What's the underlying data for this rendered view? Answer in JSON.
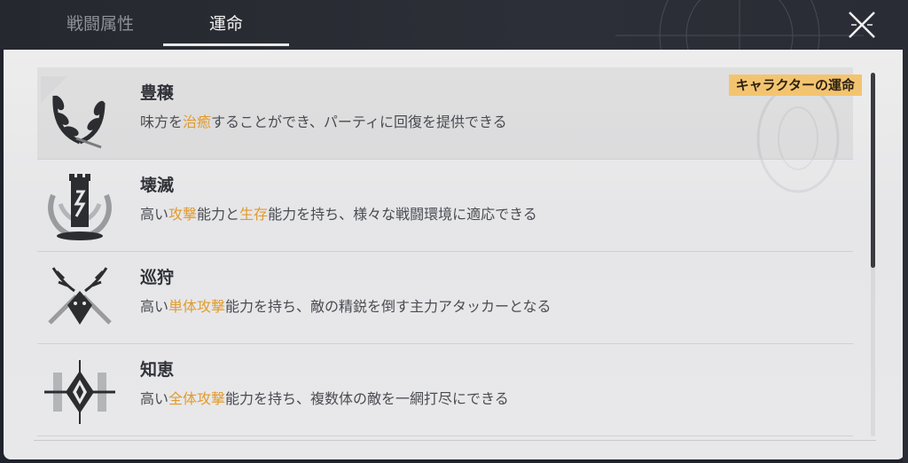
{
  "tabs": [
    {
      "label": "戦闘属性",
      "active": false
    },
    {
      "label": "運命",
      "active": true
    }
  ],
  "paths": [
    {
      "title": "豊穣",
      "selected": true,
      "badge": "キャラクターの運命",
      "icon": "abundance-wheat-icon",
      "desc_parts": [
        {
          "text": "味方を",
          "hl": false
        },
        {
          "text": "治癒",
          "hl": true
        },
        {
          "text": "することができ、パーティに回復を提供できる",
          "hl": false
        }
      ]
    },
    {
      "title": "壊滅",
      "selected": false,
      "icon": "destruction-tower-icon",
      "desc_parts": [
        {
          "text": "高い",
          "hl": false
        },
        {
          "text": "攻撃",
          "hl": true
        },
        {
          "text": "能力と",
          "hl": false
        },
        {
          "text": "生存",
          "hl": true
        },
        {
          "text": "能力を持ち、様々な戦闘環境に適応できる",
          "hl": false
        }
      ]
    },
    {
      "title": "巡狩",
      "selected": false,
      "icon": "hunt-stag-icon",
      "desc_parts": [
        {
          "text": "高い",
          "hl": false
        },
        {
          "text": "単体攻撃",
          "hl": true
        },
        {
          "text": "能力を持ち、敵の精鋭を倒す主力アタッカーとなる",
          "hl": false
        }
      ]
    },
    {
      "title": "知恵",
      "selected": false,
      "icon": "erudition-crystal-icon",
      "desc_parts": [
        {
          "text": "高い",
          "hl": false
        },
        {
          "text": "全体攻撃",
          "hl": true
        },
        {
          "text": "能力を持ち、複数体の敵を一網打尽にできる",
          "hl": false
        }
      ]
    }
  ],
  "colors": {
    "highlight": "#e29b2c",
    "badge_bg": "#f3c470",
    "panel_bg": "#ececec",
    "topbar_bg": "#2a2c34"
  },
  "scroll": {
    "position": 0.0
  }
}
